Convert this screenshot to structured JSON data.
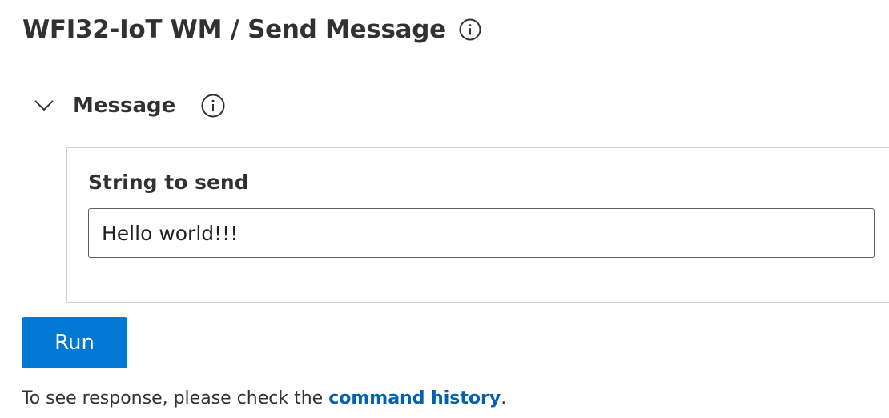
{
  "header": {
    "title": "WFI32-IoT WM / Send Message",
    "info_icon": "info-circle-icon"
  },
  "section": {
    "title": "Message",
    "expanded": true,
    "chevron_icon": "chevron-down-icon",
    "info_icon": "info-circle-icon"
  },
  "form": {
    "field_label": "String to send",
    "field_value": "Hello world!!!"
  },
  "actions": {
    "run_label": "Run",
    "run_color": "#0078d4"
  },
  "footer": {
    "hint_prefix": "To see response, please check the ",
    "hint_link": "command history",
    "hint_suffix": ".",
    "link_color": "#0062ad"
  }
}
